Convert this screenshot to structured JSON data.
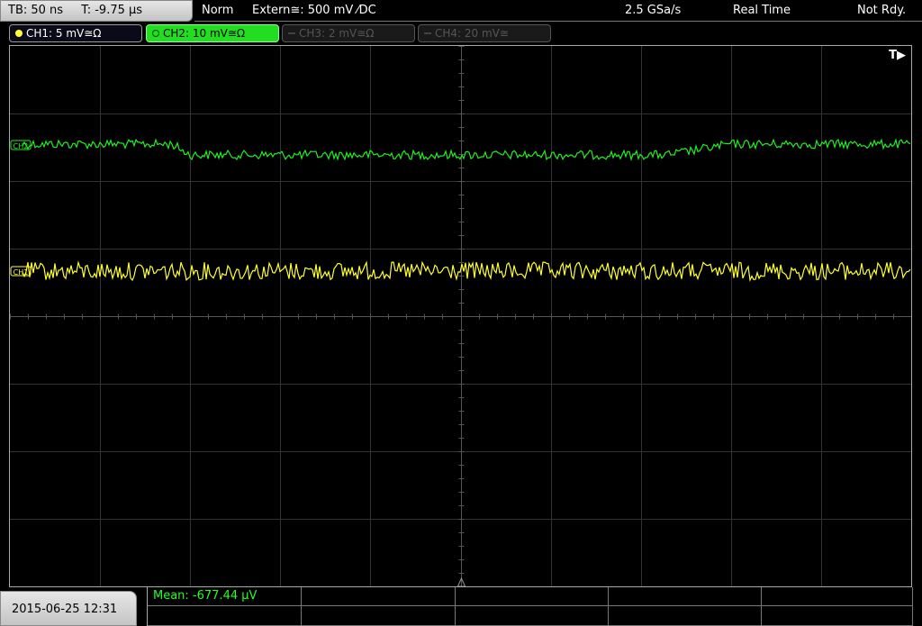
{
  "status": {
    "timebase": "TB: 50 ns",
    "trigger_time": "T: -9.75 µs",
    "mode": "Norm",
    "trigger_source": "Extern≅: 500 mV ⁄DC",
    "sample_rate": "2.5 GSa/s",
    "acq_mode": "Real Time",
    "state": "Not Rdy."
  },
  "channels": [
    {
      "label": "CH1: 5 mV≅Ω",
      "color": "#ffff33",
      "active": true
    },
    {
      "label": "CH2: 10 mV≅Ω",
      "color": "#22dd22",
      "active": true
    },
    {
      "label": "CH3: 2 mV≅Ω",
      "color": "#555555",
      "active": false
    },
    {
      "label": "CH4: 20 mV≅",
      "color": "#555555",
      "active": false
    }
  ],
  "scope": {
    "trigger_marker": "T▶",
    "ch1_marker": "CH1",
    "ch2_marker": "CH2"
  },
  "footer": {
    "datetime": "2015-06-25 12:31",
    "mean": "Mean: -677.44 µV"
  }
}
